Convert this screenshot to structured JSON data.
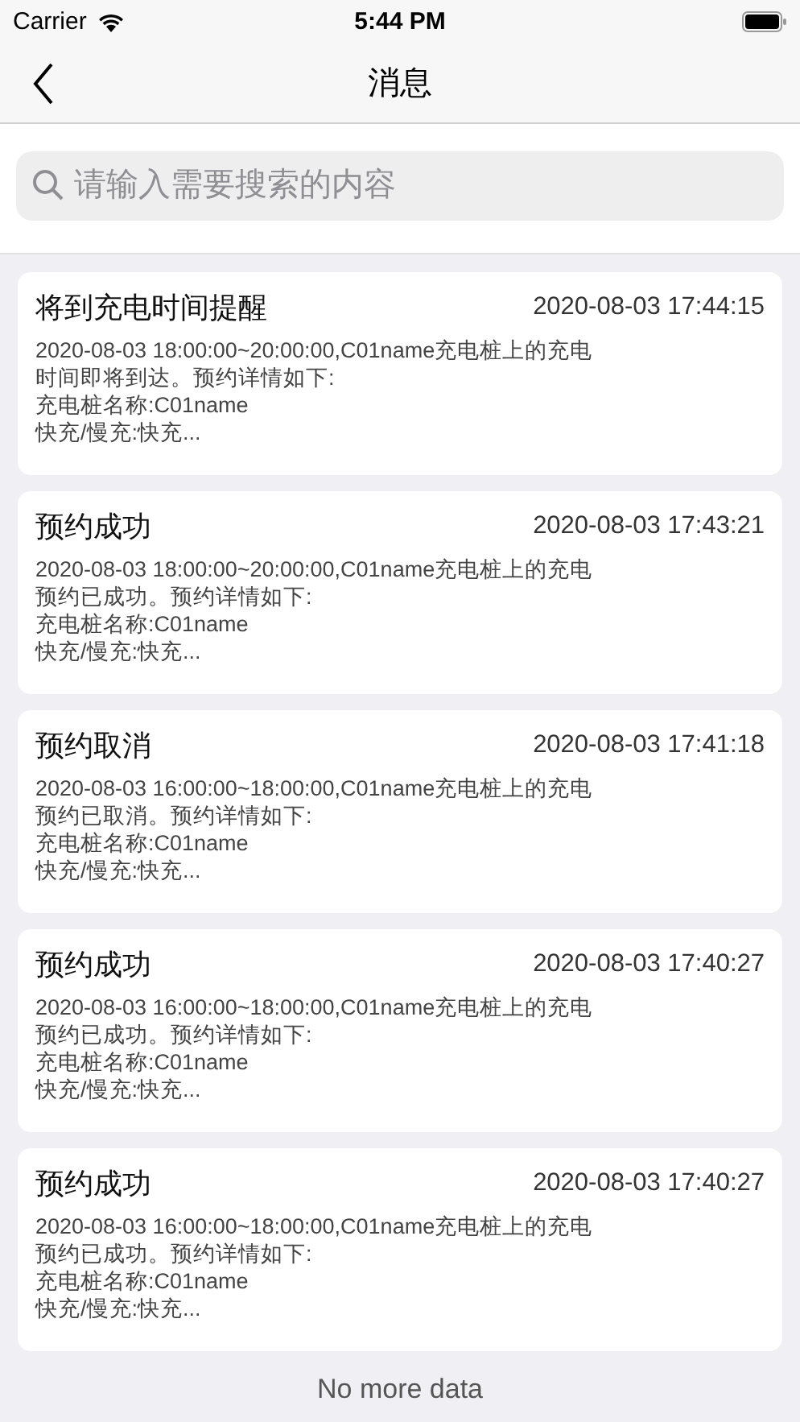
{
  "status_bar": {
    "carrier": "Carrier",
    "time": "5:44 PM"
  },
  "nav": {
    "title": "消息"
  },
  "search": {
    "placeholder": "请输入需要搜索的内容"
  },
  "messages": [
    {
      "title": "将到充电时间提醒",
      "time": "2020-08-03 17:44:15",
      "lines": [
        "2020-08-03 18:00:00~20:00:00,C01name充电桩上的充电",
        "时间即将到达。预约详情如下:",
        "充电桩名称:C01name",
        "快充/慢充:快充..."
      ]
    },
    {
      "title": "预约成功",
      "time": "2020-08-03 17:43:21",
      "lines": [
        "2020-08-03 18:00:00~20:00:00,C01name充电桩上的充电",
        "预约已成功。预约详情如下:",
        "充电桩名称:C01name",
        "快充/慢充:快充..."
      ]
    },
    {
      "title": "预约取消",
      "time": "2020-08-03 17:41:18",
      "lines": [
        "2020-08-03 16:00:00~18:00:00,C01name充电桩上的充电",
        "预约已取消。预约详情如下:",
        "充电桩名称:C01name",
        "快充/慢充:快充..."
      ]
    },
    {
      "title": "预约成功",
      "time": "2020-08-03 17:40:27",
      "lines": [
        "2020-08-03 16:00:00~18:00:00,C01name充电桩上的充电",
        "预约已成功。预约详情如下:",
        "充电桩名称:C01name",
        "快充/慢充:快充..."
      ]
    },
    {
      "title": "预约成功",
      "time": "2020-08-03 17:40:27",
      "lines": [
        "2020-08-03 16:00:00~18:00:00,C01name充电桩上的充电",
        "预约已成功。预约详情如下:",
        "充电桩名称:C01name",
        "快充/慢充:快充..."
      ]
    }
  ],
  "footer": "No more data"
}
